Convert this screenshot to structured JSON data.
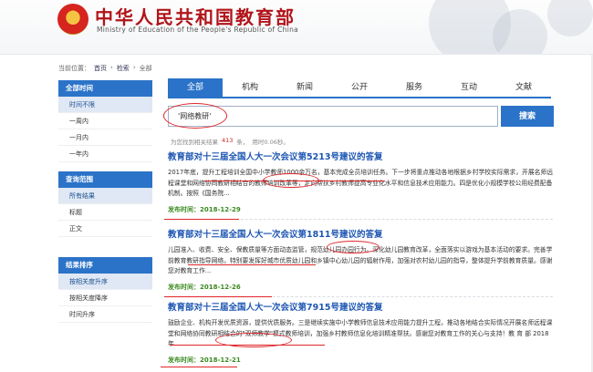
{
  "header": {
    "title": "中华人民共和国教育部",
    "subtitle": "Ministry of Education of the People's Republic of China",
    "emblem_icon": "national-emblem-icon"
  },
  "breadcrumb": {
    "prefix": "当前位置：",
    "items": [
      "首页",
      "检索",
      "全部"
    ],
    "separator": "›"
  },
  "sidebar": {
    "groups": [
      {
        "heading": "全部时间",
        "items": [
          "时间不限",
          "一周内",
          "一月内",
          "一年内"
        ],
        "selected": 0
      },
      {
        "heading": "查询范围",
        "items": [
          "所有结果",
          "标题",
          "正文"
        ],
        "selected": 0
      },
      {
        "heading": "结果排序",
        "items": [
          "按相关度升序",
          "按相关度降序",
          "时间升序"
        ],
        "selected": 0
      }
    ]
  },
  "tabs": {
    "items": [
      "全部",
      "机构",
      "新闻",
      "公开",
      "服务",
      "互动",
      "文献"
    ],
    "active": 0
  },
  "search": {
    "value": "'网络教研'",
    "button_label": "搜索"
  },
  "result_info": {
    "prefix": "为您找到相关结果",
    "count": "413",
    "unit": "条，",
    "time": "用时0.06秒。"
  },
  "results": [
    {
      "title": "教育部对十三届全国人大一次会议第5213号建议的答复",
      "snippet": "2017年底，提升工程培训全国中小学教师1000余万名，基本完成全员培训任务。下一步将重点推动各地根据乡村学校实际需求，开展名师远程课堂和网络协同教研相结合的教师培训改革等，定向帮扶乡村教师提高专业化水平和信息技术应用能力。四是优化小规模学校公用经费配备机制。按照《国务院...",
      "date": "发布时间：2018-12-29"
    },
    {
      "title": "教育部对十三届全国人大一次会议第1811号建议的答复",
      "snippet": "儿园准入、收费、安全、保教质量等方面动态监管，规范幼儿园办园行为。深化幼儿园教育改革，全面落实以游戏为基本活动的要求。完善学前教育教研指导网络，特别要发挥好城市优质幼儿园和乡镇中心幼儿园的辐射作用，加强对农村幼儿园的指导，整体提升学前教育质量。感谢您对教育工作...",
      "date": "发布时间：2018-12-26"
    },
    {
      "title": "教育部对十三届全国人大一次会议第7915号建议的答复",
      "snippet": "鼓励企业、机构开发优质资源，提供优质服务。三是继续实施中小学教师信息技术应用能力提升工程，推动各地结合实际情况开展名师远程课堂和网络协同教研相结合的\"双师教学\"模式教师培训，加强乡村教师信息化培训精准帮扶。感谢您对教育工作的关心与支持！教 育 部 2018年...",
      "date": "发布时间：2018-12-21"
    }
  ],
  "colors": {
    "brand_red": "#b1141a",
    "accent_blue": "#2b73c8",
    "link_blue": "#1d56b3",
    "date_green": "#3a8a1f",
    "annotation_red": "#e0262a"
  }
}
